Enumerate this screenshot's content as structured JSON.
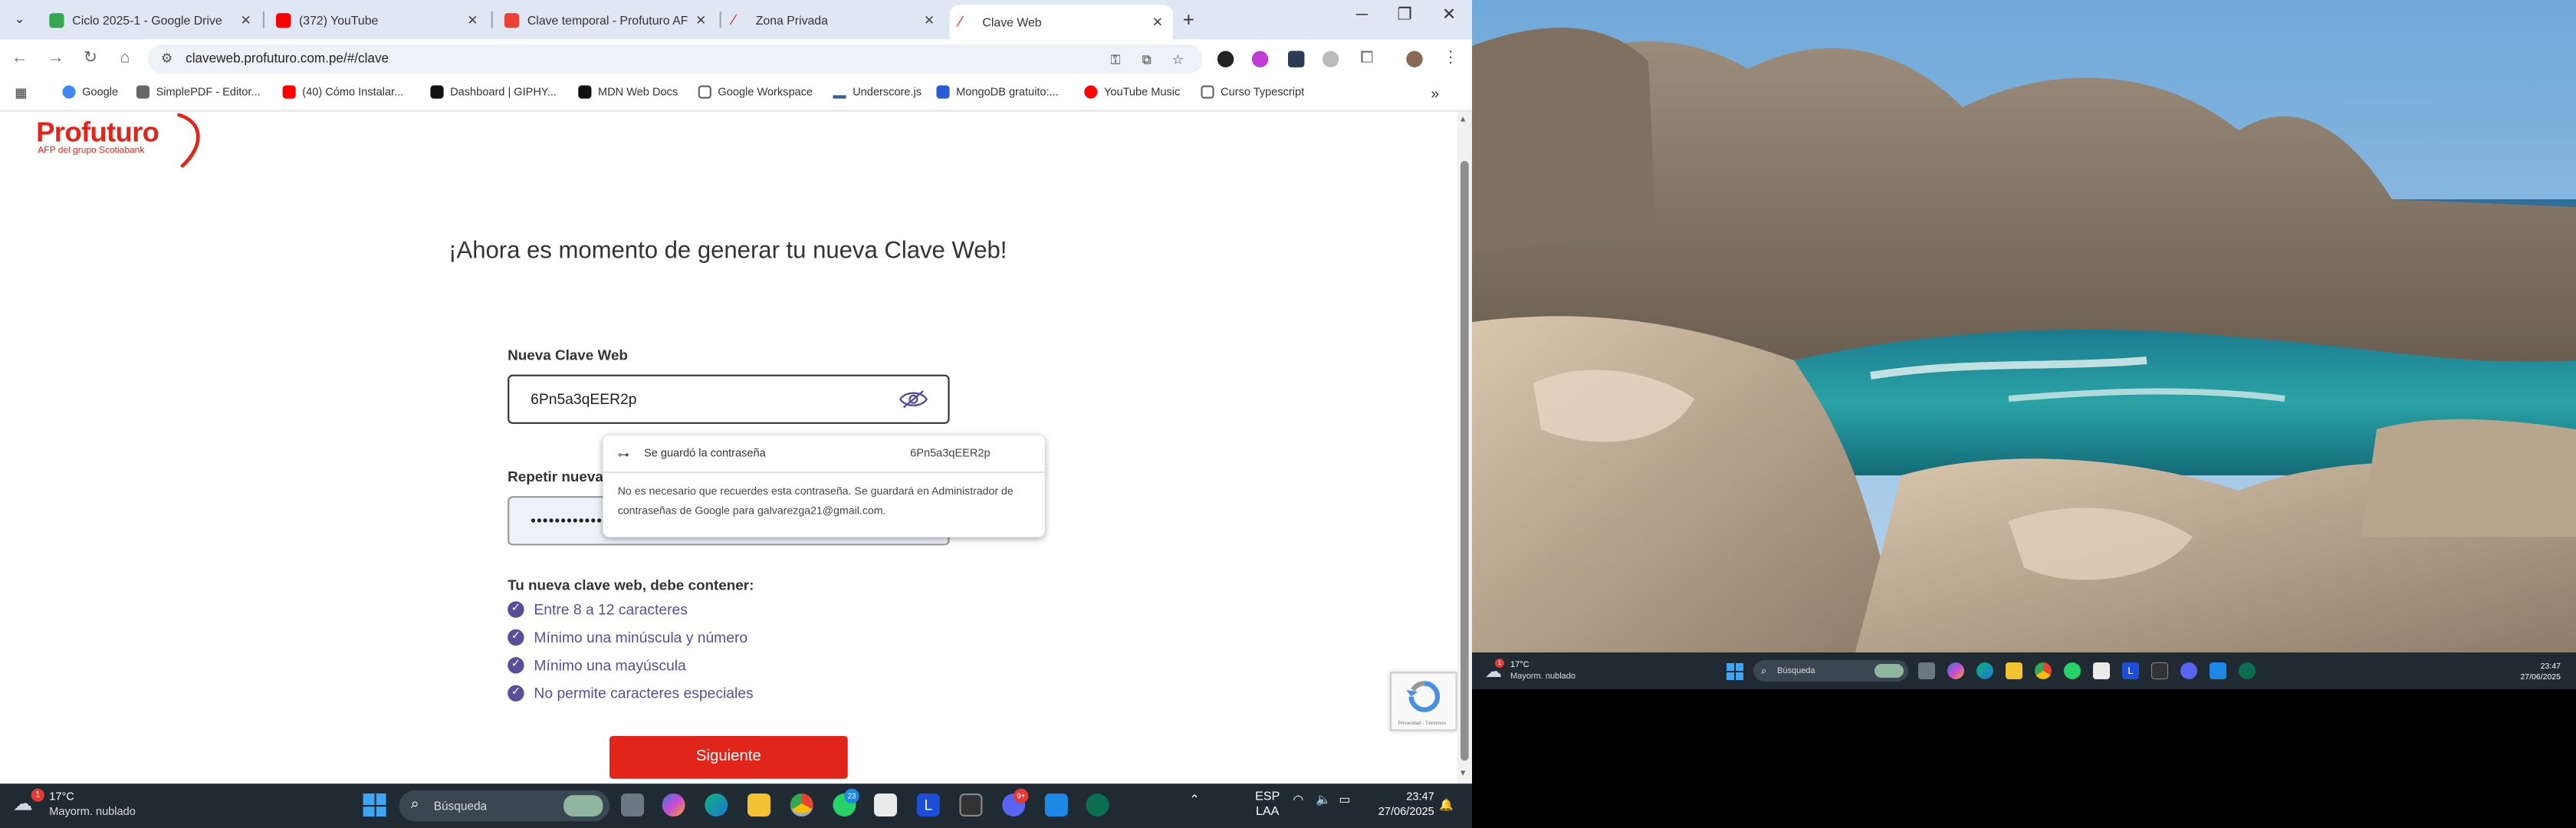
{
  "browser": {
    "tabs": [
      {
        "title": "Ciclo 2025-1 - Google Drive",
        "icon": "google-drive-icon",
        "color": "#34a853"
      },
      {
        "title": "(372) YouTube",
        "icon": "youtube-icon",
        "color": "#ff0000"
      },
      {
        "title": "Clave temporal - Profuturo AFP",
        "icon": "gmail-icon",
        "color": "#ea4335"
      },
      {
        "title": "Zona Privada",
        "icon": "profuturo-icon",
        "color": "#e1251b"
      },
      {
        "title": "Clave Web",
        "icon": "profuturo-icon",
        "color": "#e1251b"
      }
    ],
    "active_tab": 4,
    "url": "claveweb.profuturo.com.pe/#/clave",
    "bookmarks": [
      {
        "label": "Google",
        "color": "#4285f4"
      },
      {
        "label": "SimplePDF - Editor...",
        "color": "#555"
      },
      {
        "label": "(40) Cómo Instalar...",
        "color": "#ff0000"
      },
      {
        "label": "Dashboard | GIPHY...",
        "color": "#111"
      },
      {
        "label": "MDN Web Docs",
        "color": "#111"
      },
      {
        "label": "Google Workspace",
        "color": "#777"
      },
      {
        "label": "Underscore.js",
        "color": "#3b5998"
      },
      {
        "label": "MongoDB gratuito:...",
        "color": "#2a5bd7"
      },
      {
        "label": "YouTube Music",
        "color": "#ff0000"
      },
      {
        "label": "Curso Typescript",
        "color": "#777"
      }
    ]
  },
  "page": {
    "logo_text": "Profuturo",
    "logo_sub": "AFP del grupo Scotiabank",
    "heading": "¡Ahora es momento de generar tu nueva Clave Web!",
    "new_password_label": "Nueva Clave Web",
    "new_password_value": "6Pn5a3qEER2p",
    "repeat_password_label": "Repetir nueva",
    "repeat_password_value": "••••••••••••",
    "requirements_title": "Tu nueva clave web, debe contener:",
    "requirements": [
      "Entre 8 a 12 caracteres",
      "Mínimo una minúscula y número",
      "Mínimo una mayúscula",
      "No permite caracteres especiales"
    ],
    "next_button": "Siguiente",
    "recaptcha_text": "Privacidad - Términos"
  },
  "password_popup": {
    "saved_text": "Se guardó la contraseña",
    "password": "6Pn5a3qEER2p",
    "message": "No es necesario que recuerdes esta contraseña. Se guardará en Administrador de contraseñas de Google para galvarezga21@gmail.com."
  },
  "taskbar": {
    "temperature": "17°C",
    "weather": "Mayorm. nublado",
    "weather_badge": "1",
    "search_placeholder": "Búsqueda",
    "lang_top": "ESP",
    "lang_bottom": "LAA",
    "time": "23:47",
    "date": "27/06/2025",
    "badge_whatsapp": "23",
    "badge_discord": "9+"
  },
  "taskbar_right": {
    "temperature": "17°C",
    "weather": "Mayorm. nublado",
    "search_placeholder": "Búsqueda",
    "time": "23:47",
    "date": "27/06/2025"
  },
  "colors": {
    "brand_red": "#e1251b",
    "check_purple": "#5a4e9a",
    "taskbar": "#1f2a33"
  }
}
